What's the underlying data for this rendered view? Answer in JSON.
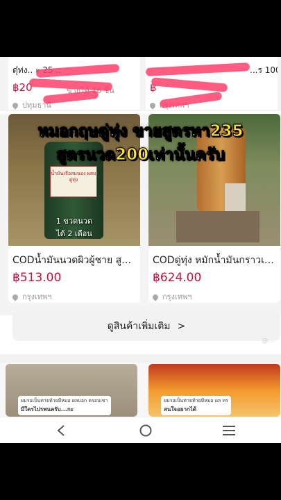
{
  "top_row": [
    {
      "title": "ดุ๋ท่ง.. ะ 25 ..",
      "price": "฿20",
      "sold": "ขายได้ 16 ชิ้น",
      "location": "ปทุมธานี"
    },
    {
      "title": "...ร 100% .",
      "price": "฿",
      "sold": "",
      "location": "กรุงเทพฯ"
    }
  ],
  "overlay": {
    "line1_prefix": "หมอกฤษดู่ทุ่ง ขายสูตรทา",
    "line1_number": "235",
    "line2_prefix": "สูตรนวด",
    "line2_number": "200",
    "line2_suffix": "เท่านั้นครับ"
  },
  "products": [
    {
      "title": "CODน้ำมันนวดผิวผู้ชาย สูตร...",
      "price": "฿513.00",
      "location": "กรุงเทพฯ",
      "image_label": "น้ำมันเจือสมนอง ผสมดู่ทุ่ง",
      "image_caption1": "1 ขวดนวด",
      "image_caption2": "ได้ 2 เดือน"
    },
    {
      "title": "CODดู่ทุ่ง หมักน้ำมันกราวเครื...",
      "price": "฿624.00",
      "location": "กรุงเทพฯ"
    }
  ],
  "more_button": {
    "label": "ดูสินค้าเพิ่มเติม",
    "chevron": ">"
  },
  "watermark": "@...",
  "feed": [
    {
      "caption_small": "ผมรอเป็นทายท้ายมีหมอ ผลบอก ครอบเขา",
      "caption_main": "มีใครไปรพนครับ...กะ"
    },
    {
      "caption_small": "ผมรอเป็นทายท้ายมีหมอ ผล ทร",
      "caption_main": "สนใจอยากได้"
    }
  ],
  "nav": {
    "back": "back-icon",
    "home": "home-icon",
    "menu": "menu-icon"
  },
  "colors": {
    "price": "#c0123c",
    "overlay_gold": "#ffe436",
    "scribble": "#ff3f6b"
  }
}
